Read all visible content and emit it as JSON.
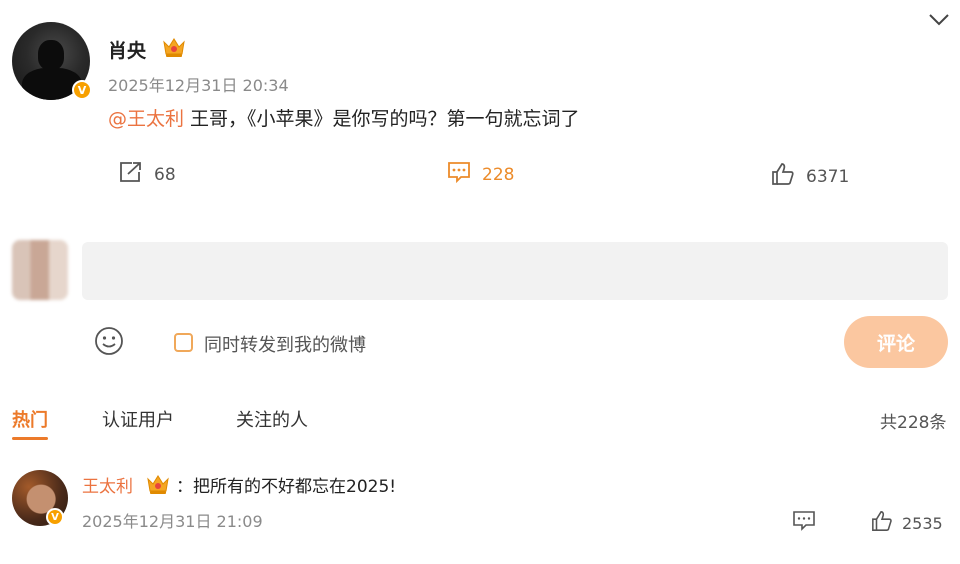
{
  "post": {
    "username": "肖央",
    "verified_badge": "V",
    "timestamp": "2025年12月31日 20:34",
    "mention": "@王太利",
    "text": " 王哥，《小苹果》是你写的吗？第一句就忘词了",
    "shares": "68",
    "comments": "228",
    "likes": "6371"
  },
  "composer": {
    "placeholder": "",
    "repost_label": "同时转发到我的微博",
    "submit_label": "评论"
  },
  "tabs": {
    "hot": "热门",
    "verified": "认证用户",
    "following": "关注的人",
    "total": "共228条"
  },
  "reply": {
    "username": "王太利",
    "verified_badge": "V",
    "text": "：把所有的不好都忘在2025!",
    "timestamp": "2025年12月31日 21:09",
    "likes": "2535"
  },
  "colors": {
    "accent": "#eb7340",
    "comment_orange": "#ec8b2a",
    "submit_bg": "#fbc7a0",
    "input_bg": "#f2f2f2",
    "badge": "#f7a000"
  },
  "icons": {
    "share": "share-icon",
    "comment": "comment-icon",
    "like": "thumbs-up-icon",
    "emoji": "emoji-icon",
    "crown": "crown-icon",
    "chevron": "chevron-down-icon"
  }
}
